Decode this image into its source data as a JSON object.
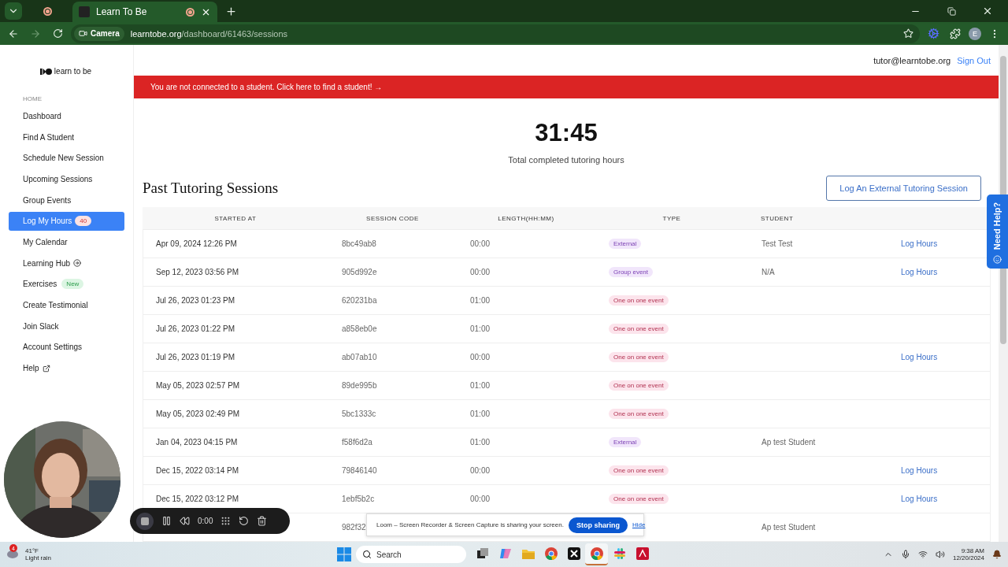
{
  "browser": {
    "tabs": [
      {
        "title": "Learn To Be",
        "selected": true
      }
    ],
    "camera_chip": "Camera",
    "url_host": "learntobe.org",
    "url_path": "/dashboard/61463/sessions",
    "profile_initial": "E"
  },
  "sidebar": {
    "logo": "learn to be",
    "section": "HOME",
    "items": [
      {
        "label": "Dashboard",
        "selected": false,
        "kind": "link"
      },
      {
        "label": "Find A Student",
        "selected": false,
        "kind": "link"
      },
      {
        "label": "Schedule New Session",
        "selected": false,
        "kind": "link"
      },
      {
        "label": "Upcoming Sessions",
        "selected": false,
        "kind": "link"
      },
      {
        "label": "Group Events",
        "selected": false,
        "kind": "link"
      },
      {
        "label": "Log My Hours",
        "selected": true,
        "kind": "link",
        "badge": "40"
      },
      {
        "label": "My Calendar",
        "selected": false,
        "kind": "link"
      },
      {
        "label": "Learning Hub",
        "selected": false,
        "kind": "hub"
      },
      {
        "label": "Exercises",
        "selected": false,
        "kind": "link",
        "tag": "New"
      },
      {
        "label": "Create Testimonial",
        "selected": false,
        "kind": "link"
      },
      {
        "label": "Join Slack",
        "selected": false,
        "kind": "link"
      },
      {
        "label": "Account Settings",
        "selected": false,
        "kind": "link"
      },
      {
        "label": "Help",
        "selected": false,
        "kind": "external"
      }
    ]
  },
  "header": {
    "email": "tutor@learntobe.org",
    "sign_out": "Sign Out"
  },
  "alert": "You are not connected to a student. Click here to find a student! →",
  "total": {
    "value": "31:45",
    "label": "Total completed tutoring hours"
  },
  "sessions": {
    "title": "Past Tutoring Sessions",
    "log_external": "Log An External Tutoring Session",
    "columns": [
      "STARTED AT",
      "SESSION CODE",
      "LENGTH(HH:MM)",
      "TYPE",
      "STUDENT"
    ],
    "rows": [
      {
        "started": "Apr 09, 2024 12:26 PM",
        "code": "8bc49ab8",
        "length": "00:00",
        "type": {
          "label": "External",
          "kind": "external"
        },
        "student": "Test Test",
        "action": "Log Hours"
      },
      {
        "started": "Sep 12, 2023 03:56 PM",
        "code": "905d992e",
        "length": "00:00",
        "type": {
          "label": "Group event",
          "kind": "group"
        },
        "student": "N/A",
        "action": "Log Hours"
      },
      {
        "started": "Jul 26, 2023 01:23 PM",
        "code": "620231ba",
        "length": "01:00",
        "type": {
          "label": "One on one event",
          "kind": "one_on_one"
        }
      },
      {
        "started": "Jul 26, 2023 01:22 PM",
        "code": "a858eb0e",
        "length": "01:00",
        "type": {
          "label": "One on one event",
          "kind": "one_on_one"
        }
      },
      {
        "started": "Jul 26, 2023 01:19 PM",
        "code": "ab07ab10",
        "length": "00:00",
        "type": {
          "label": "One on one event",
          "kind": "one_on_one"
        },
        "action": "Log Hours"
      },
      {
        "started": "May 05, 2023 02:57 PM",
        "code": "89de995b",
        "length": "01:00",
        "type": {
          "label": "One on one event",
          "kind": "one_on_one"
        }
      },
      {
        "started": "May 05, 2023 02:49 PM",
        "code": "5bc1333c",
        "length": "01:00",
        "type": {
          "label": "One on one event",
          "kind": "one_on_one"
        }
      },
      {
        "started": "Jan 04, 2023 04:15 PM",
        "code": "f58f6d2a",
        "length": "01:00",
        "type": {
          "label": "External",
          "kind": "external"
        },
        "student": "Ap test Student"
      },
      {
        "started": "Dec 15, 2022 03:14 PM",
        "code": "79846140",
        "length": "00:00",
        "type": {
          "label": "One on one event",
          "kind": "one_on_one"
        },
        "action": "Log Hours"
      },
      {
        "started": "Dec 15, 2022 03:12 PM",
        "code": "1ebf5b2c",
        "length": "00:00",
        "type": {
          "label": "One on one event",
          "kind": "one_on_one"
        },
        "action": "Log Hours"
      },
      {
        "code": "982f32",
        "student": "Ap test Student"
      }
    ]
  },
  "help_tab": "Need Help?",
  "recorder": {
    "time": "0:00"
  },
  "share_notice": {
    "message": "Loom – Screen Recorder & Screen Capture is sharing your screen.",
    "stop": "Stop sharing",
    "hide": "Hide"
  },
  "taskbar": {
    "weather_badge": "4",
    "temperature": "41°F",
    "weather": "Light rain",
    "search_placeholder": "Search",
    "apps": [
      {
        "kind": "taskview",
        "selected": false
      },
      {
        "kind": "copilot",
        "selected": false
      },
      {
        "kind": "files",
        "selected": false
      },
      {
        "kind": "chrome",
        "selected": false
      },
      {
        "kind": "xapp",
        "selected": false
      },
      {
        "kind": "chrome",
        "selected": true
      },
      {
        "kind": "slack",
        "selected": false
      },
      {
        "kind": "acrobat",
        "selected": false
      }
    ],
    "time": "9:38 AM",
    "date": "12/20/2024"
  }
}
